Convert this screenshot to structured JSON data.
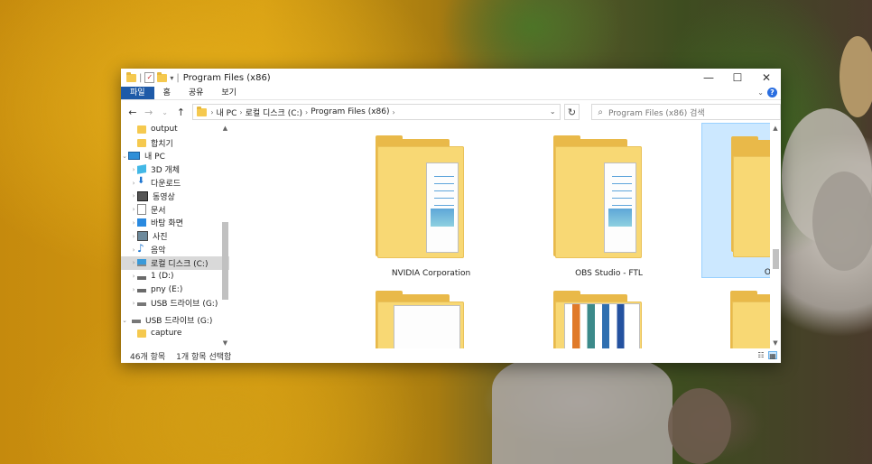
{
  "window": {
    "title": "Program Files (x86)",
    "controls": {
      "minimize": "—",
      "maximize": "☐",
      "close": "✕"
    }
  },
  "quick_access": {
    "separator": "|",
    "check_glyph": "✓",
    "dropdown": "▾",
    "divider": "|"
  },
  "ribbon": {
    "tabs": [
      "파일",
      "홈",
      "공유",
      "보기"
    ],
    "caret": "⌄",
    "help": "?"
  },
  "nav": {
    "back": "←",
    "forward": "→",
    "recent": "⌄",
    "up": "↑",
    "crumb_sep": "›",
    "breadcrumbs": [
      "내 PC",
      "로컬 디스크 (C:)",
      "Program Files (x86)"
    ],
    "address_dropdown": "⌄",
    "refresh": "↻",
    "search_icon": "⌕",
    "search_placeholder": "Program Files (x86) 검색"
  },
  "sidebar": {
    "items": [
      {
        "chev": "",
        "icon": "folder-icon",
        "label": "output"
      },
      {
        "chev": "",
        "icon": "folder-icon",
        "label": "합치기"
      },
      {
        "chev": "⌄",
        "icon": "pc-icon",
        "label": "내 PC"
      },
      {
        "chev": "›",
        "icon": "3d-objects-icon",
        "label": "3D 개체"
      },
      {
        "chev": "›",
        "icon": "download-icon",
        "label": "다운로드"
      },
      {
        "chev": "›",
        "icon": "video-icon",
        "label": "동영상"
      },
      {
        "chev": "›",
        "icon": "document-icon",
        "label": "문서"
      },
      {
        "chev": "›",
        "icon": "desktop-icon",
        "label": "바탕 화면"
      },
      {
        "chev": "›",
        "icon": "pictures-icon",
        "label": "사진"
      },
      {
        "chev": "›",
        "icon": "music-icon",
        "label": "음악"
      },
      {
        "chev": "›",
        "icon": "windows-drive-icon",
        "label": "로컬 디스크 (C:)"
      },
      {
        "chev": "›",
        "icon": "drive-icon",
        "label": "1 (D:)"
      },
      {
        "chev": "›",
        "icon": "drive-icon",
        "label": "pny (E:)"
      },
      {
        "chev": "›",
        "icon": "usb-drive-icon",
        "label": "USB 드라이브 (G:)"
      },
      {
        "chev": "⌄",
        "icon": "usb-drive-icon",
        "label": "USB 드라이브 (G:)"
      },
      {
        "chev": "",
        "icon": "folder-icon",
        "label": "capture"
      }
    ],
    "scroll_up": "▲",
    "scroll_down": "▼"
  },
  "content": {
    "tiles": [
      {
        "label": "NVIDIA Corporation"
      },
      {
        "label": "OBS Studio - FTL"
      },
      {
        "label": "Origin"
      },
      {
        "label": ""
      },
      {
        "label": ""
      },
      {
        "label": ""
      }
    ],
    "scroll_up": "▲",
    "scroll_down": "▼"
  },
  "status": {
    "item_count": "46개 항목",
    "selected": "1개 항목 선택함",
    "view_details": "☷",
    "view_large": "▦"
  }
}
